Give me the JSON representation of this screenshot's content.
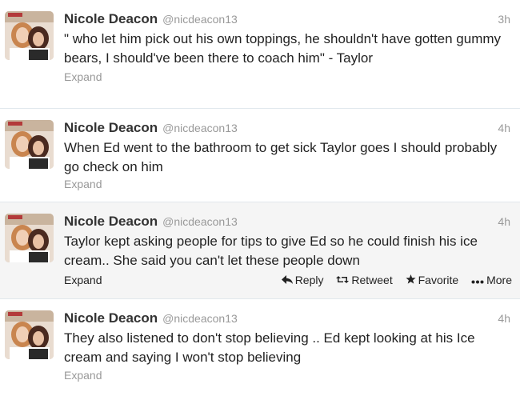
{
  "tweets": [
    {
      "fullname": "Nicole Deacon",
      "username": "@nicdeacon13",
      "time": "3h",
      "text": "\" who let him pick out his own toppings, he shouldn't have gotten gummy bears, I should've been there to coach him\" - Taylor",
      "expand": "Expand"
    },
    {
      "fullname": "Nicole Deacon",
      "username": "@nicdeacon13",
      "time": "4h",
      "text": "When Ed went to the bathroom to get sick Taylor goes I should probably go check on him",
      "expand": "Expand"
    },
    {
      "fullname": "Nicole Deacon",
      "username": "@nicdeacon13",
      "time": "4h",
      "text": "Taylor kept asking people for tips to give Ed so he could finish his ice cream.. She said you can't let these people down",
      "expand": "Expand",
      "actions": {
        "reply": "Reply",
        "retweet": "Retweet",
        "favorite": "Favorite",
        "more": "More"
      }
    },
    {
      "fullname": "Nicole Deacon",
      "username": "@nicdeacon13",
      "time": "4h",
      "text": "They also listened to don't stop believing .. Ed kept looking at his Ice cream and saying I won't stop believing",
      "expand": "Expand"
    }
  ],
  "colors": {
    "hover_background": "#f5f5f5",
    "muted_text": "#999999",
    "border": "#e1e8ed"
  },
  "icons": {
    "reply": "reply-icon",
    "retweet": "retweet-icon",
    "favorite": "star-icon",
    "more": "more-dots-icon"
  }
}
